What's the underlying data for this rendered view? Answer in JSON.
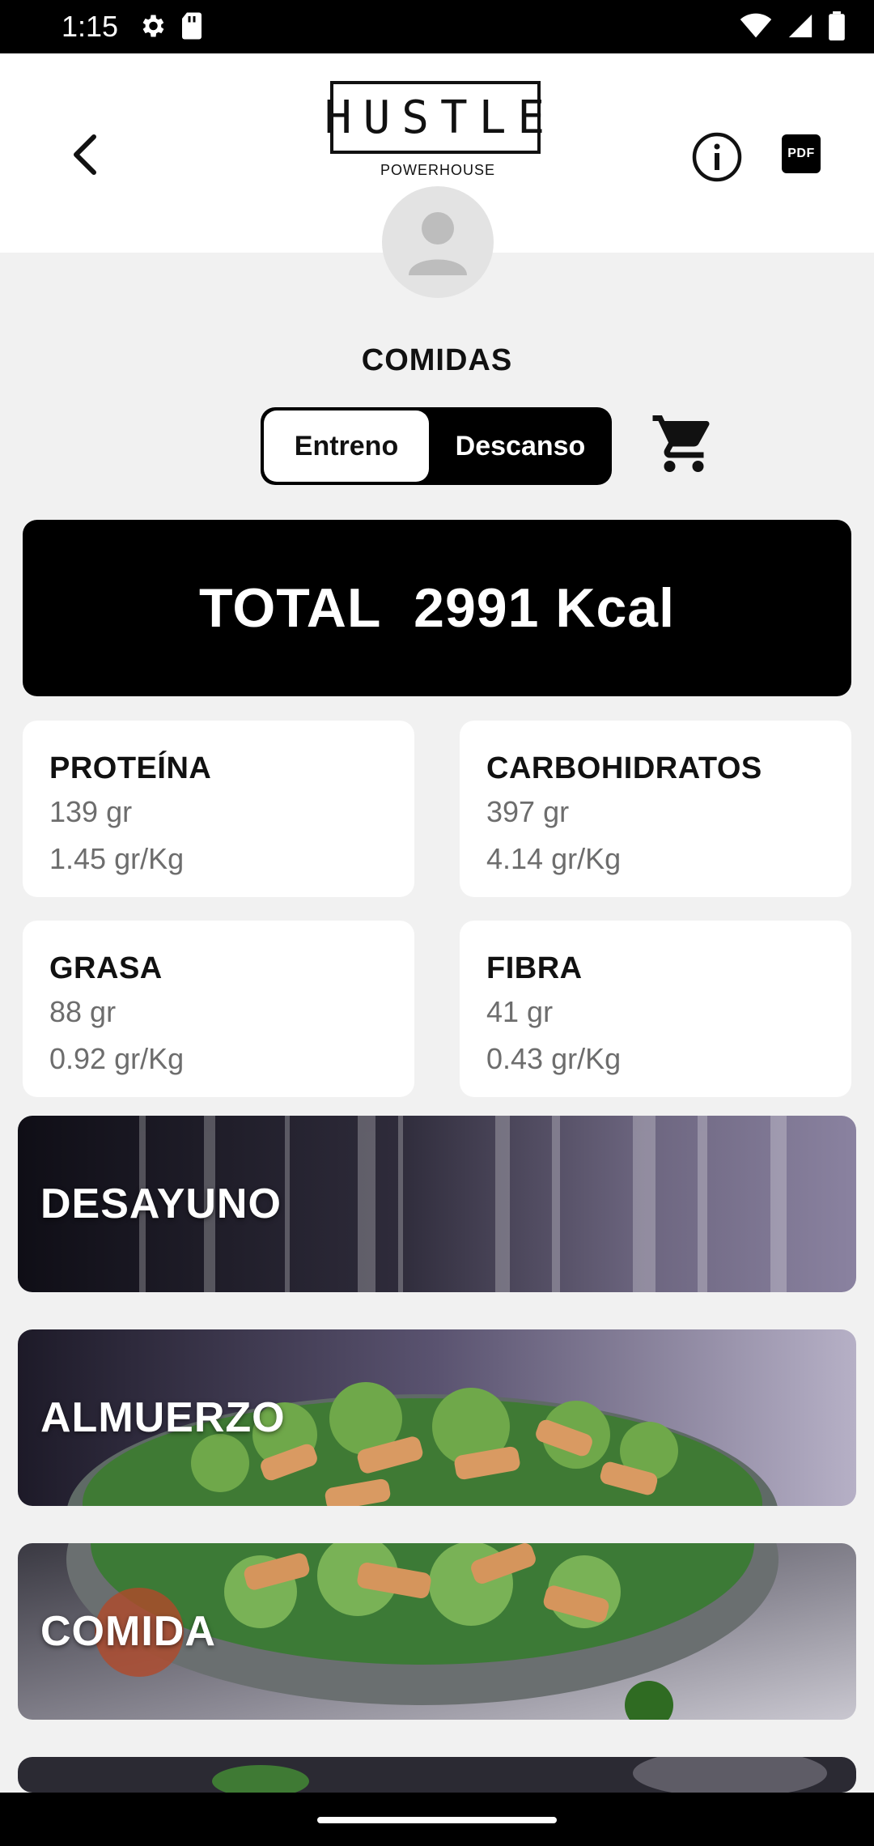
{
  "status_bar": {
    "time": "1:15",
    "icons_left": [
      "settings-gear-icon",
      "sd-card-icon"
    ],
    "icons_right": [
      "wifi-icon",
      "cell-signal-icon",
      "battery-icon"
    ]
  },
  "header": {
    "logo_text": "HUSTLE",
    "logo_subtext": "POWERHOUSE",
    "pdf_label": "PDF"
  },
  "section_title": "COMIDAS",
  "toggle": {
    "options": [
      "Entreno",
      "Descanso"
    ],
    "selected": "Entreno"
  },
  "total": {
    "label": "TOTAL",
    "value": "2991",
    "unit": "Kcal"
  },
  "macros": [
    {
      "name": "PROTEÍNA",
      "grams": "139 gr",
      "per_kg": "1.45 gr/Kg"
    },
    {
      "name": "CARBOHIDRATOS",
      "grams": "397 gr",
      "per_kg": "4.14 gr/Kg"
    },
    {
      "name": "GRASA",
      "grams": "88 gr",
      "per_kg": "0.92 gr/Kg"
    },
    {
      "name": "FIBRA",
      "grams": "41 gr",
      "per_kg": "0.43 gr/Kg"
    }
  ],
  "meals": [
    {
      "label": "DESAYUNO"
    },
    {
      "label": "ALMUERZO"
    },
    {
      "label": "COMIDA"
    }
  ],
  "colors": {
    "background": "#f1f1f1",
    "card": "#ffffff",
    "primary": "#000000",
    "muted_text": "#6d6d6d"
  }
}
